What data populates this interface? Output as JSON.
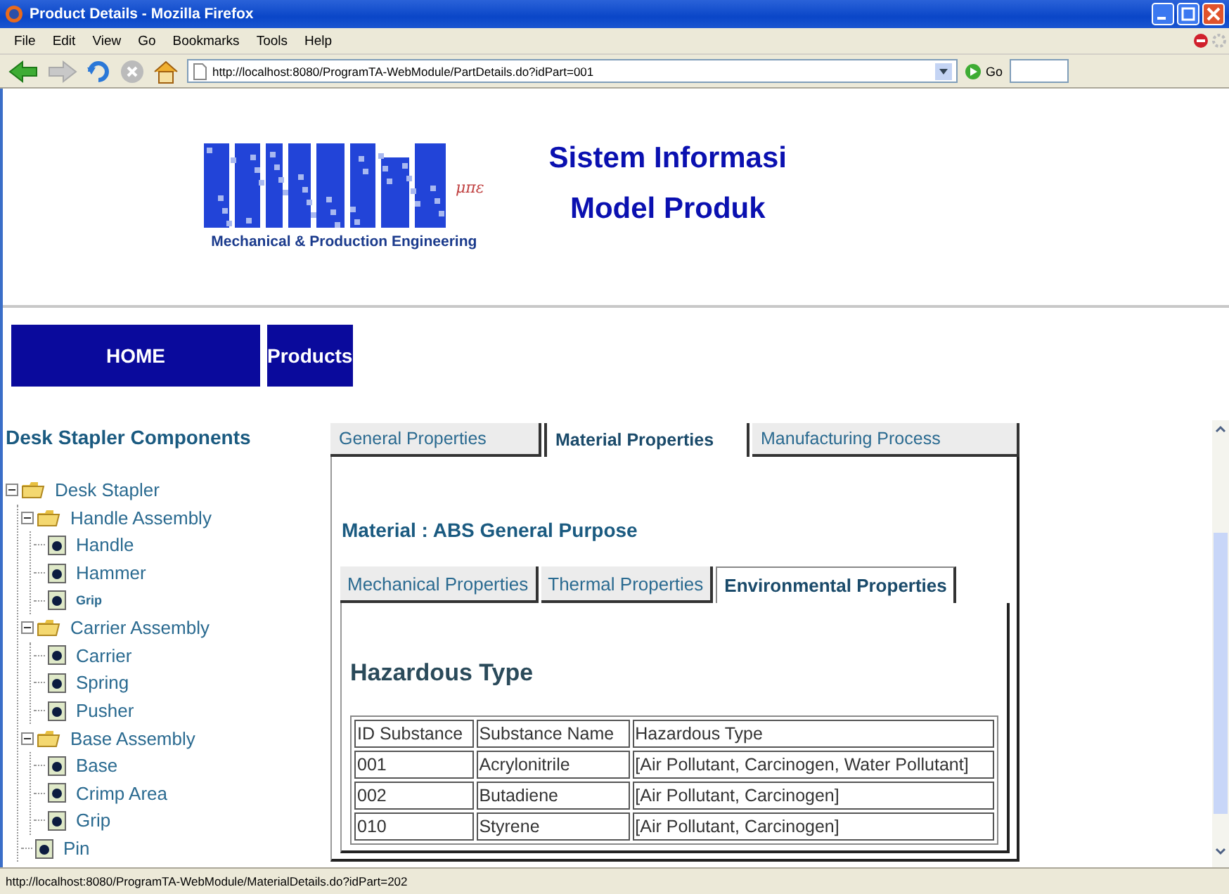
{
  "window": {
    "title": "Product Details - Mozilla Firefox"
  },
  "menu": [
    "File",
    "Edit",
    "View",
    "Go",
    "Bookmarks",
    "Tools",
    "Help"
  ],
  "toolbar": {
    "address": "http://localhost:8080/ProgramTA-WebModule/PartDetails.do?idPart=001",
    "go_label": "Go"
  },
  "header": {
    "logo_caption": "Mechanical & Production Engineering",
    "logo_mark": "μπε",
    "title_lines": [
      "Sistem Informasi",
      "Model Produk"
    ]
  },
  "nav": [
    {
      "label": "HOME"
    },
    {
      "label": "Products"
    }
  ],
  "sidebar": {
    "title": "Desk Stapler Components",
    "tree": [
      {
        "label": "Desk Stapler",
        "kind": "folder",
        "expanded": true,
        "selected": false,
        "children": [
          {
            "label": "Handle Assembly",
            "kind": "folder",
            "expanded": true,
            "selected": false,
            "children": [
              {
                "label": "Handle",
                "kind": "part",
                "selected": false
              },
              {
                "label": "Hammer",
                "kind": "part",
                "selected": false
              },
              {
                "label": "Grip",
                "kind": "part",
                "selected": true
              }
            ]
          },
          {
            "label": "Carrier Assembly",
            "kind": "folder",
            "expanded": true,
            "selected": false,
            "children": [
              {
                "label": "Carrier",
                "kind": "part",
                "selected": false
              },
              {
                "label": "Spring",
                "kind": "part",
                "selected": false
              },
              {
                "label": "Pusher",
                "kind": "part",
                "selected": false
              }
            ]
          },
          {
            "label": "Base Assembly",
            "kind": "folder",
            "expanded": true,
            "selected": false,
            "children": [
              {
                "label": "Base",
                "kind": "part",
                "selected": false
              },
              {
                "label": "Crimp Area",
                "kind": "part",
                "selected": false
              },
              {
                "label": "Grip",
                "kind": "part",
                "selected": false
              }
            ]
          },
          {
            "label": "Pin",
            "kind": "part",
            "selected": false
          }
        ]
      }
    ]
  },
  "tabs": [
    {
      "label": "General Properties",
      "selected": false
    },
    {
      "label": "Material Properties",
      "selected": true
    },
    {
      "label": "Manufacturing Process",
      "selected": false
    }
  ],
  "material_title": "Material : ABS General Purpose",
  "subtabs": [
    {
      "label": "Mechanical Properties",
      "selected": false
    },
    {
      "label": "Thermal Properties",
      "selected": false
    },
    {
      "label": "Environmental Properties",
      "selected": true
    }
  ],
  "section_title": "Hazardous Type",
  "table": {
    "columns": [
      "ID Substance",
      "Substance Name",
      "Hazardous Type"
    ],
    "rows": [
      [
        "001",
        "Acrylonitrile",
        "[Air Pollutant, Carcinogen, Water Pollutant]"
      ],
      [
        "002",
        "Butadiene",
        "[Air Pollutant, Carcinogen]"
      ],
      [
        "010",
        "Styrene",
        "[Air Pollutant, Carcinogen]"
      ]
    ]
  },
  "status_bar": "http://localhost:8080/ProgramTA-WebModule/MaterialDetails.do?idPart=202"
}
